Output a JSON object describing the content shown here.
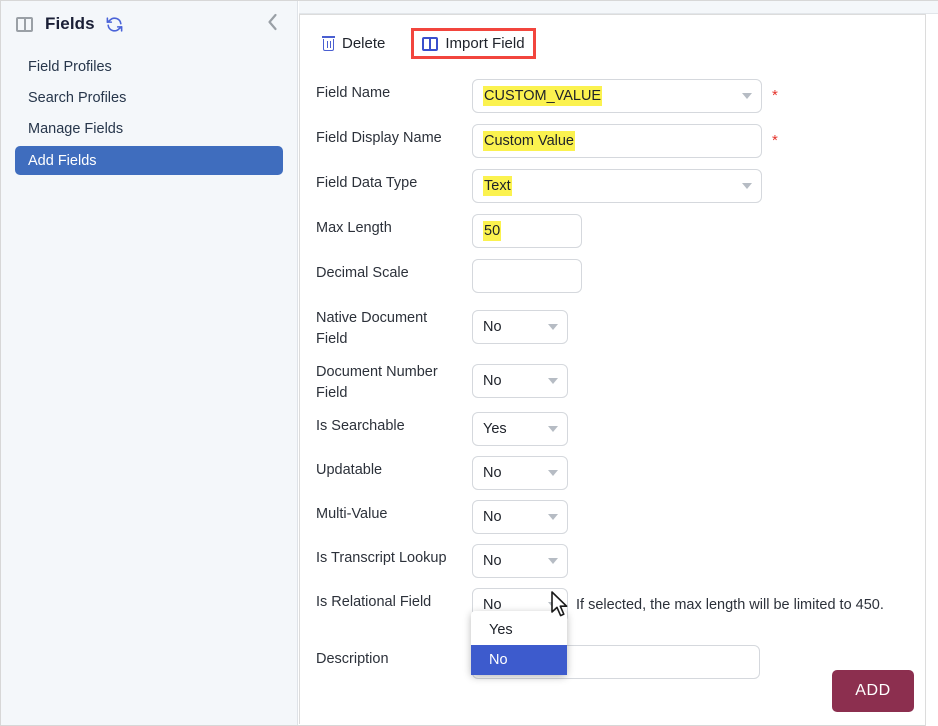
{
  "sidebar": {
    "panel_icon": "panel-columns-icon",
    "title": "Fields",
    "refresh_icon": "refresh-icon",
    "collapse_icon": "chevron-left-icon",
    "items": [
      {
        "label": "Field Profiles",
        "active": false
      },
      {
        "label": "Search Profiles",
        "active": false
      },
      {
        "label": "Manage Fields",
        "active": false
      },
      {
        "label": "Add Fields",
        "active": true
      }
    ],
    "active_bg": "#3f6dbe"
  },
  "toolbar": {
    "delete_label": "Delete",
    "delete_icon": "trash-icon",
    "import_label": "Import Field",
    "import_icon": "panel-columns-icon",
    "highlight_color": "#f2453d"
  },
  "form": {
    "fields": [
      {
        "label": "Field Name",
        "value": "CUSTOM_VALUE",
        "type": "select",
        "highlighted": true,
        "required": true
      },
      {
        "label": "Field Display Name",
        "value": "Custom Value",
        "type": "text",
        "highlighted": true,
        "required": true
      },
      {
        "label": "Field Data Type",
        "value": "Text",
        "type": "select",
        "highlighted": true,
        "required": false
      },
      {
        "label": "Max Length",
        "value": "50",
        "type": "text",
        "highlighted": true,
        "required": false
      },
      {
        "label": "Decimal Scale",
        "value": "",
        "type": "text",
        "highlighted": false,
        "required": false
      },
      {
        "label": "Native Document Field",
        "value": "No",
        "type": "select",
        "highlighted": false,
        "required": false
      },
      {
        "label": "Document Number Field",
        "value": "No",
        "type": "select",
        "highlighted": false,
        "required": false
      },
      {
        "label": "Is Searchable",
        "value": "Yes",
        "type": "select",
        "highlighted": false,
        "required": false
      },
      {
        "label": "Updatable",
        "value": "No",
        "type": "select",
        "highlighted": false,
        "required": false
      },
      {
        "label": "Multi-Value",
        "value": "No",
        "type": "select",
        "highlighted": false,
        "required": false
      },
      {
        "label": "Is Transcript Lookup",
        "value": "No",
        "type": "select",
        "highlighted": false,
        "required": false
      },
      {
        "label": "Is Relational Field",
        "value": "No",
        "type": "select",
        "highlighted": false,
        "required": false
      },
      {
        "label": "Description",
        "value": "",
        "type": "text",
        "highlighted": false,
        "required": false
      }
    ],
    "labels": {
      "field_name": "Field Name",
      "field_display_name": "Field Display Name",
      "field_data_type": "Field Data Type",
      "max_length": "Max Length",
      "decimal_scale": "Decimal Scale",
      "native_document_field_l1": "Native Document",
      "native_document_field_l2": "Field",
      "document_number_field_l1": "Document Number",
      "document_number_field_l2": "Field",
      "is_searchable": "Is Searchable",
      "updatable": "Updatable",
      "multi_value": "Multi-Value",
      "is_transcript_lookup": "Is Transcript Lookup",
      "is_relational_field": "Is Relational Field",
      "description": "Description"
    },
    "values": {
      "field_name": "CUSTOM_VALUE",
      "field_display_name": "Custom Value",
      "field_data_type": "Text",
      "max_length": "50",
      "decimal_scale": "",
      "native_document_field": "No",
      "document_number_field": "No",
      "is_searchable": "Yes",
      "updatable": "No",
      "multi_value": "No",
      "is_transcript_lookup": "No",
      "is_relational_field": "No",
      "description": ""
    },
    "relational_hint": "If selected, the max length will be limited to 450.",
    "required_marker": "*",
    "highlight_color": "#fbf24f"
  },
  "dropdown": {
    "open": true,
    "field": "Is Relational Field",
    "options": [
      {
        "label": "Yes",
        "selected": false
      },
      {
        "label": "No",
        "selected": true
      }
    ],
    "selected_bg": "#3d5bcd"
  },
  "footer": {
    "add_label": "ADD",
    "add_color": "#8c2f4f"
  }
}
